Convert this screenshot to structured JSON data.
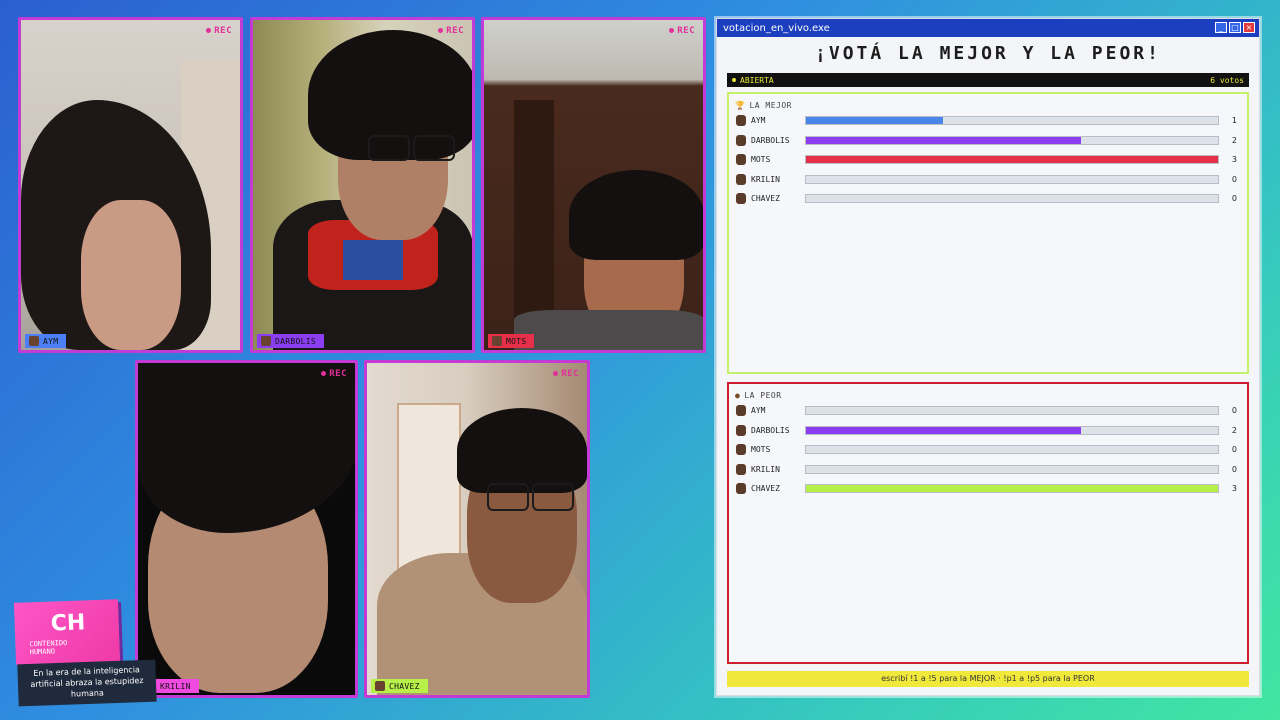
{
  "tiles": [
    {
      "name": "AYM",
      "rec": "REC",
      "tag_color": "#4c7ff5"
    },
    {
      "name": "DARBOLIS",
      "rec": "REC",
      "tag_color": "#8b3df0"
    },
    {
      "name": "MOTS",
      "rec": "REC",
      "tag_color": "#e6304a"
    },
    {
      "name": "KRILIN",
      "rec": "REC",
      "tag_color": "#f04ae0"
    },
    {
      "name": "CHAVEZ",
      "rec": "REC",
      "tag_color": "#b8f04a"
    }
  ],
  "window": {
    "title": "votacion_en_vivo.exe",
    "headline": "¡VOTÁ LA MEJOR Y LA PEOR!",
    "status": "ABIERTA",
    "votes": "6 votos",
    "best": {
      "title": "LA MEJOR",
      "rows": [
        {
          "name": "AYM",
          "count": "1",
          "fraction": 0.333,
          "color": "#4a86ea"
        },
        {
          "name": "DARBOLIS",
          "count": "2",
          "fraction": 0.667,
          "color": "#8b3df0"
        },
        {
          "name": "MOTS",
          "count": "3",
          "fraction": 1.0,
          "color": "#e6304a"
        },
        {
          "name": "KRILIN",
          "count": "0",
          "fraction": 0,
          "color": "#888888"
        },
        {
          "name": "CHAVEZ",
          "count": "0",
          "fraction": 0,
          "color": "#888888"
        }
      ]
    },
    "worst": {
      "title": "LA PEOR",
      "rows": [
        {
          "name": "AYM",
          "count": "0",
          "fraction": 0,
          "color": "#888888"
        },
        {
          "name": "DARBOLIS",
          "count": "2",
          "fraction": 0.667,
          "color": "#8b3df0"
        },
        {
          "name": "MOTS",
          "count": "0",
          "fraction": 0,
          "color": "#888888"
        },
        {
          "name": "KRILIN",
          "count": "0",
          "fraction": 0,
          "color": "#888888"
        },
        {
          "name": "CHAVEZ",
          "count": "3",
          "fraction": 1.0,
          "color": "#b8f04a"
        }
      ]
    },
    "footer": "escribí !1 a !5 para la MEJOR · !p1 a !p5 para la PEOR"
  },
  "logo": {
    "mark": "CH",
    "sub1": "CONTENIDO",
    "sub2": "HUMANO",
    "tagline": "En la era de la inteligencia artificial abraza la estupidez humana"
  }
}
